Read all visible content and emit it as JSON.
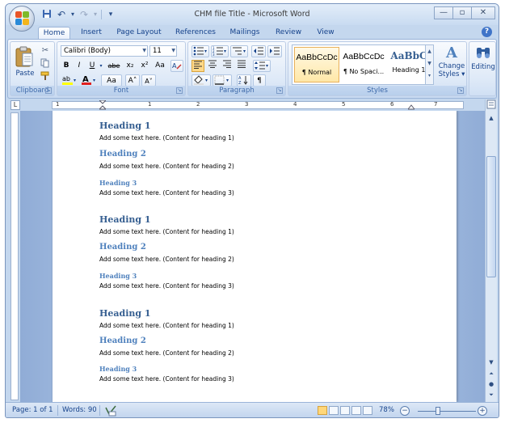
{
  "window": {
    "title": "CHM file Title - Microsoft Word",
    "controls": {
      "minimize": "—",
      "maximize": "▫",
      "close": "✕"
    }
  },
  "qat": {
    "save": "💾",
    "undo": "↶",
    "redo": "↷",
    "dropdown": "▾",
    "undo_drop": "▾",
    "redo_drop": "▾"
  },
  "tabs": [
    {
      "label": "Home"
    },
    {
      "label": "Insert"
    },
    {
      "label": "Page Layout"
    },
    {
      "label": "References"
    },
    {
      "label": "Mailings"
    },
    {
      "label": "Review"
    },
    {
      "label": "View"
    }
  ],
  "ribbon": {
    "clipboard": {
      "label": "Clipboard",
      "paste": "Paste"
    },
    "font": {
      "label": "Font",
      "font_name": "Calibri (Body)",
      "font_size": "11",
      "bold": "B",
      "italic": "I",
      "underline": "U",
      "strike": "abe",
      "subscript": "x₂",
      "superscript": "x²",
      "font_color": "A",
      "change_case": "Aa",
      "grow": "A˄",
      "shrink": "A˅"
    },
    "paragraph": {
      "label": "Paragraph",
      "pilcrow": "¶"
    },
    "styles": {
      "label": "Styles",
      "items": [
        {
          "sample": "AaBbCcDc",
          "name": "¶ Normal"
        },
        {
          "sample": "AaBbCcDc",
          "name": "¶ No Spaci..."
        },
        {
          "sample": "AaBbC",
          "name": "Heading 1"
        }
      ],
      "change_styles_line1": "Change",
      "change_styles_line2": "Styles ▾"
    },
    "editing": {
      "label": "Editing"
    }
  },
  "ruler": {
    "numbers": [
      "1",
      "1",
      "2",
      "3",
      "4",
      "5",
      "6",
      "7"
    ]
  },
  "document": {
    "blocks": [
      {
        "h1": "Heading 1",
        "t1": "Add some text here. (Content for heading 1)",
        "h2": "Heading 2",
        "t2": "Add some text here. (Content for heading 2)",
        "h3": "Heading 3",
        "t3": "Add some text here. (Content for heading 3)"
      },
      {
        "h1": "Heading 1",
        "t1": "Add some text here. (Content for heading 1)",
        "h2": "Heading 2",
        "t2": "Add some text here. (Content for heading 2)",
        "h3": "Heading 3",
        "t3": "Add some text here. (Content for heading 3)"
      },
      {
        "h1": "Heading 1",
        "t1": "Add some text here. (Content for heading 1)",
        "h2": "Heading 2",
        "t2": "Add some text here. (Content for heading 2)",
        "h3": "Heading 3",
        "t3": "Add some text here. (Content for heading 3)"
      }
    ]
  },
  "status": {
    "page": "Page: 1 of 1",
    "words": "Words: 90",
    "zoom": "78%",
    "zoom_out": "−",
    "zoom_in": "+"
  },
  "colors": {
    "heading1": "#365f91",
    "heading2": "#4f81bd",
    "accent": "#15428b"
  }
}
